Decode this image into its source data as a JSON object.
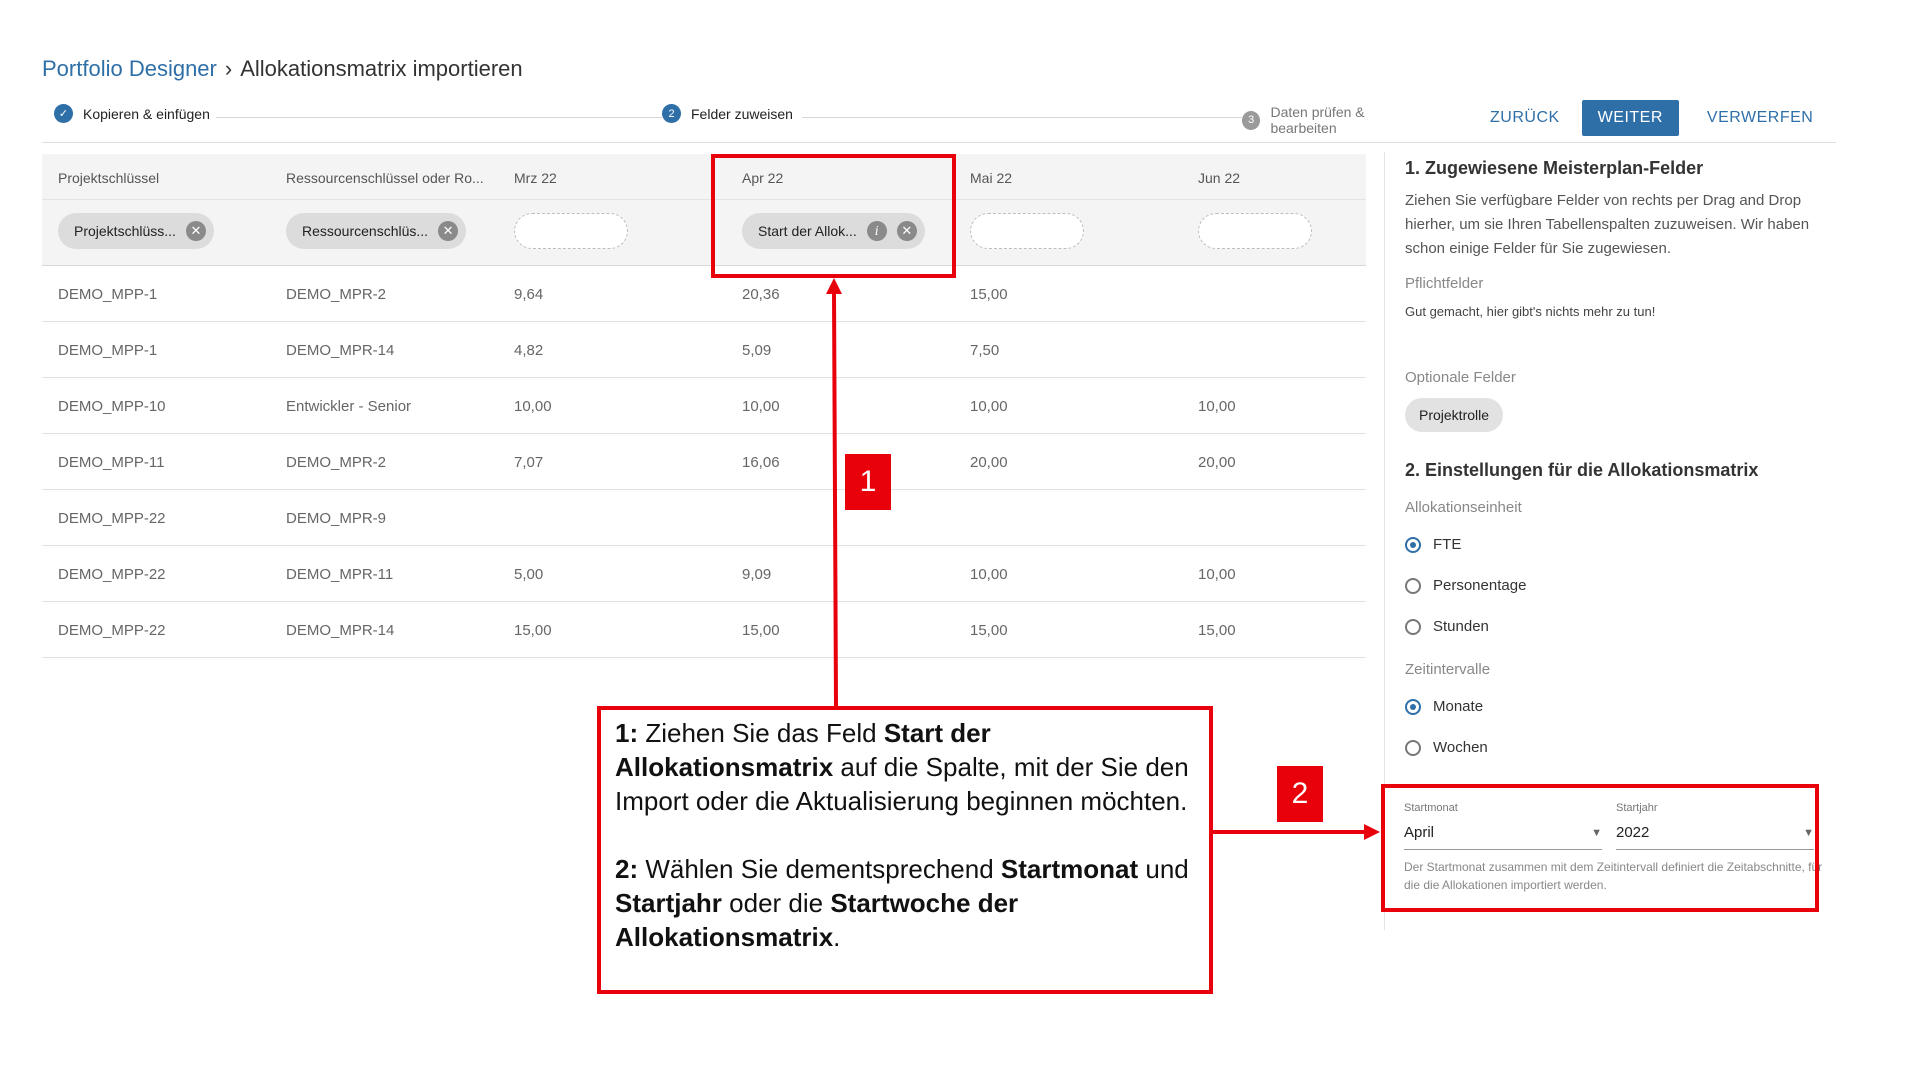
{
  "breadcrumb": {
    "root": "Portfolio Designer",
    "separator": "›",
    "current": "Allokationsmatrix importieren"
  },
  "stepper": {
    "steps": [
      {
        "label": "Kopieren & einfügen",
        "marker": "✓",
        "state": "done"
      },
      {
        "label": "Felder zuweisen",
        "marker": "2",
        "state": "active"
      },
      {
        "label": "Daten prüfen & bearbeiten",
        "marker": "3",
        "state": "inactive"
      }
    ]
  },
  "actions": {
    "back": "ZURÜCK",
    "next": "WEITER",
    "discard": "VERWERFEN"
  },
  "table": {
    "headers": [
      "Projektschlüssel",
      "Ressourcenschlüssel oder Ro...",
      "Mrz 22",
      "Apr 22",
      "Mai 22",
      "Jun 22"
    ],
    "chips": [
      "Projektschlüss...",
      "Ressourcenschlüs...",
      "",
      "Start der Allok...",
      "",
      ""
    ],
    "rows": [
      [
        "DEMO_MPP-1",
        "DEMO_MPR-2",
        "9,64",
        "20,36",
        "15,00",
        ""
      ],
      [
        "DEMO_MPP-1",
        "DEMO_MPR-14",
        "4,82",
        "5,09",
        "7,50",
        ""
      ],
      [
        "DEMO_MPP-10",
        "Entwickler - Senior",
        "10,00",
        "10,00",
        "10,00",
        "10,00"
      ],
      [
        "DEMO_MPP-11",
        "DEMO_MPR-2",
        "7,07",
        "16,06",
        "20,00",
        "20,00"
      ],
      [
        "DEMO_MPP-22",
        "DEMO_MPR-9",
        "",
        "",
        "",
        ""
      ],
      [
        "DEMO_MPP-22",
        "DEMO_MPR-11",
        "5,00",
        "9,09",
        "10,00",
        "10,00"
      ],
      [
        "DEMO_MPP-22",
        "DEMO_MPR-14",
        "15,00",
        "15,00",
        "15,00",
        "15,00"
      ]
    ]
  },
  "panel": {
    "section1_title": "1. Zugewiesene Meisterplan-Felder",
    "section1_text": "Ziehen Sie verfügbare Felder von rechts per Drag and Drop hierher, um sie Ihren Tabellenspalten zuzuweisen. Wir haben schon einige Felder für Sie zugewiesen.",
    "required_label": "Pflichtfelder",
    "required_done": "Gut gemacht, hier gibt's nichts mehr zu tun!",
    "optional_label": "Optionale Felder",
    "optional_chip": "Projektrolle",
    "section2_title": "2. Einstellungen für die Allokationsmatrix",
    "unit_label": "Allokationseinheit",
    "units": [
      {
        "label": "FTE",
        "selected": true
      },
      {
        "label": "Personentage",
        "selected": false
      },
      {
        "label": "Stunden",
        "selected": false
      }
    ],
    "interval_label": "Zeitintervalle",
    "intervals": [
      {
        "label": "Monate",
        "selected": true
      },
      {
        "label": "Wochen",
        "selected": false
      }
    ],
    "start_month_label": "Startmonat",
    "start_month_value": "April",
    "start_year_label": "Startjahr",
    "start_year_value": "2022",
    "start_hint": "Der Startmonat zusammen mit dem Zeitintervall definiert die Zeitabschnitte, für die die Allokationen importiert werden."
  },
  "annotations": {
    "badge1": "1",
    "badge2": "2",
    "c1_num": "1:",
    "c1_a": " Ziehen Sie das Feld ",
    "c1_b": "Start der Allokationsmatrix",
    "c1_c": " auf die Spalte, mit der Sie den Import oder die Aktualisierung beginnen möchten.",
    "c2_num": "2:",
    "c2_a": " Wählen Sie dementsprechend ",
    "c2_b": "Startmonat",
    "c2_c": " und ",
    "c2_d": "Startjahr",
    "c2_e": " oder die ",
    "c2_f": "Startwoche der Allokationsmatrix",
    "c2_g": "."
  },
  "colors": {
    "accent": "#2f6fa8",
    "annotation": "#e8000b"
  }
}
